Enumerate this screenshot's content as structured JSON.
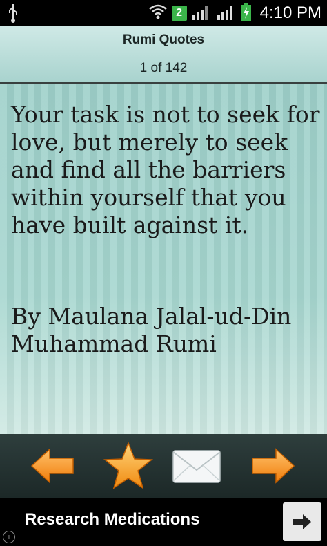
{
  "status_bar": {
    "notification_count": "2",
    "time": "4:10 PM"
  },
  "header": {
    "title": "Rumi Quotes",
    "counter": "1 of 142"
  },
  "quote": {
    "text": "Your task is not to seek for love, but merely to seek and find all the barriers within yourself that you have built against it.",
    "author": "By Maulana Jalal-ud-Din Muhammad Rumi"
  },
  "toolbar": {
    "icons": [
      "arrow-left-icon",
      "star-icon",
      "envelope-icon",
      "arrow-right-icon"
    ],
    "accent_color": "#f7941d"
  },
  "ad": {
    "text": "Research Medications",
    "info_glyph": "i"
  }
}
